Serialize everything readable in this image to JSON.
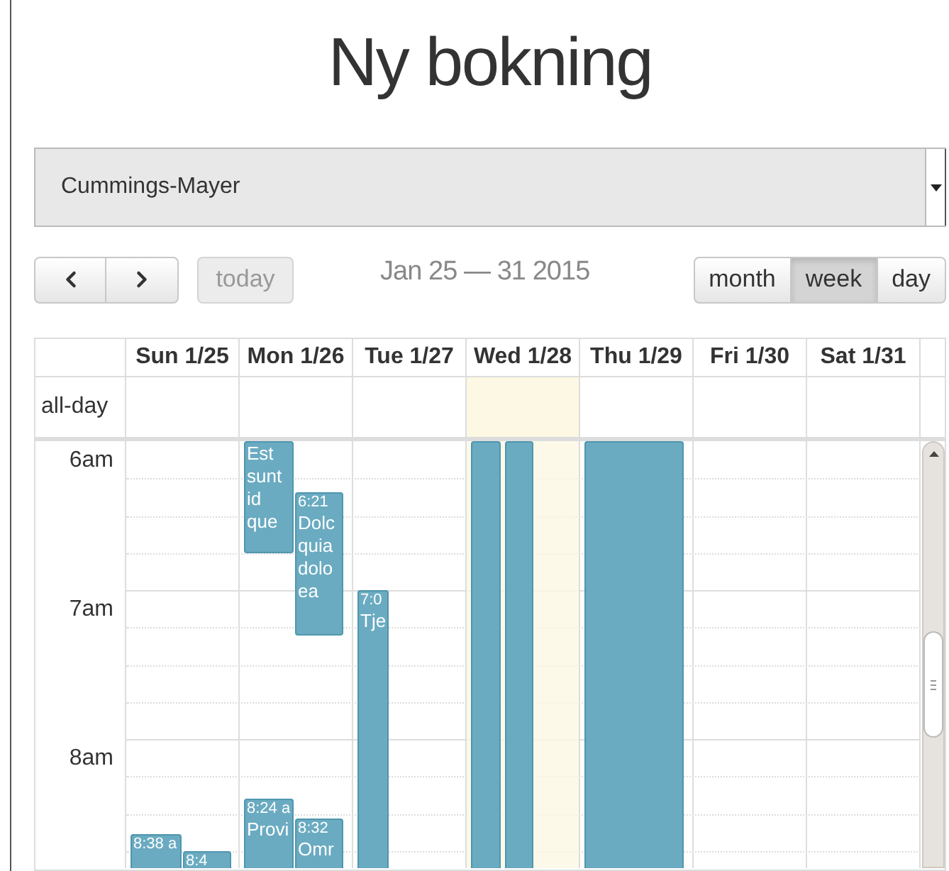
{
  "title": "Ny bokning",
  "customer_select": {
    "value": "Cummings-Mayer"
  },
  "toolbar": {
    "today": {
      "label": "today",
      "disabled": true
    },
    "range": "Jan 25 — 31 2015",
    "views": [
      {
        "label": "month",
        "selected": false
      },
      {
        "label": "week",
        "selected": true
      },
      {
        "label": "day",
        "selected": false
      }
    ]
  },
  "calendar": {
    "all_day_label": "all-day",
    "times": [
      "6am",
      "7am",
      "8am"
    ],
    "days": [
      {
        "label": "Sun 1/25",
        "today": false,
        "events": [
          {
            "kind": "event",
            "time": "8:38 a"
          },
          {
            "kind": "event",
            "time": "8:4"
          }
        ]
      },
      {
        "label": "Mon 1/26",
        "today": false,
        "events": [
          {
            "kind": "event",
            "title": "Est sunt id que"
          },
          {
            "kind": "event",
            "time": "6:21",
            "title": "Dolc quia dolo ea"
          },
          {
            "kind": "event",
            "time": "8:24 a",
            "title": "Provi"
          },
          {
            "kind": "event",
            "time": "8:32",
            "title": "Omr"
          }
        ]
      },
      {
        "label": "Tue 1/27",
        "today": false,
        "events": [
          {
            "kind": "event",
            "time": "7:0",
            "title": "Tje"
          }
        ]
      },
      {
        "label": "Wed 1/28",
        "today": true,
        "events": [
          {
            "kind": "event"
          },
          {
            "kind": "event"
          }
        ]
      },
      {
        "label": "Thu 1/29",
        "today": false,
        "events": [
          {
            "kind": "event"
          }
        ]
      },
      {
        "label": "Fri 1/30",
        "today": false
      },
      {
        "label": "Sat 1/31",
        "today": false
      }
    ]
  }
}
